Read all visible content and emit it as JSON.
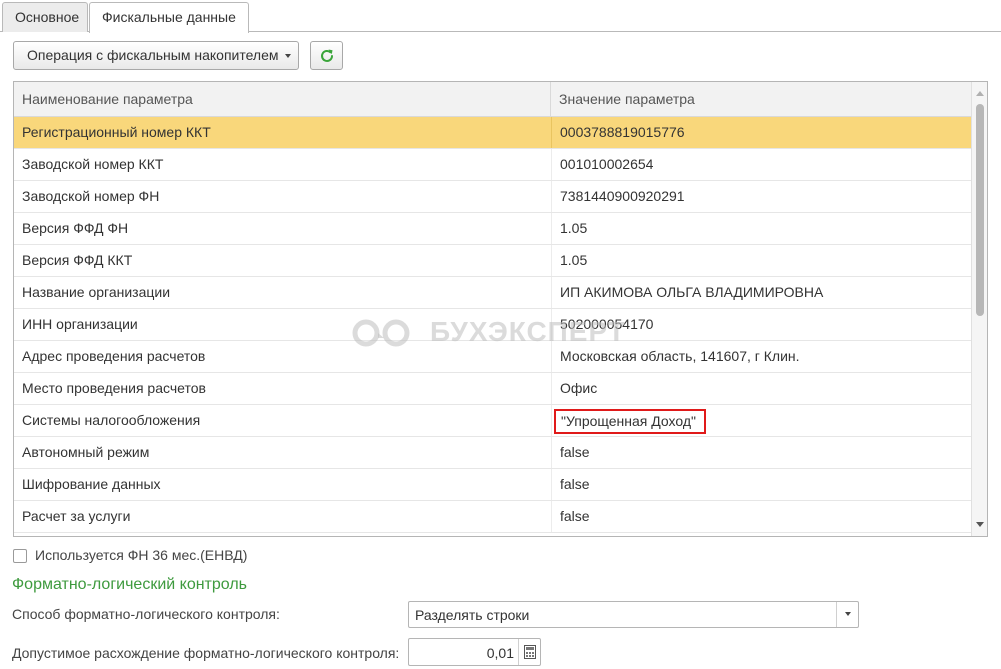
{
  "tabs": [
    {
      "label": "Основное",
      "active": false
    },
    {
      "label": "Фискальные данные",
      "active": true
    }
  ],
  "toolbar": {
    "operation_label": "Операция с фискальным накопителем",
    "refresh_icon": "refresh-icon"
  },
  "table": {
    "columns": [
      "Наименование параметра",
      "Значение параметра"
    ],
    "rows": [
      {
        "name": "Регистрационный номер ККТ",
        "value": "0003788819015776"
      },
      {
        "name": "Заводской номер ККТ",
        "value": "001010002654"
      },
      {
        "name": "Заводской номер ФН",
        "value": "7381440900920291"
      },
      {
        "name": "Версия ФФД ФН",
        "value": "1.05"
      },
      {
        "name": "Версия ФФД ККТ",
        "value": "1.05"
      },
      {
        "name": "Название организации",
        "value": "ИП АКИМОВА ОЛЬГА ВЛАДИМИРОВНА"
      },
      {
        "name": "ИНН организации",
        "value": "502000054170"
      },
      {
        "name": "Адрес проведения расчетов",
        "value": "Московская область, 141607, г Клин."
      },
      {
        "name": "Место проведения расчетов",
        "value": "Офис"
      },
      {
        "name": "Системы налогообложения",
        "value": "\"Упрощенная Доход\""
      },
      {
        "name": "Автономный режим",
        "value": "false"
      },
      {
        "name": "Шифрование данных",
        "value": "false"
      },
      {
        "name": "Расчет за услуги",
        "value": "false"
      }
    ],
    "selected_index": 0,
    "highlighted_index": 9
  },
  "watermark": "БУХЭКСПЕРТ",
  "form": {
    "fn36_label": "Используется ФН 36 мес.(ЕНВД)",
    "fn36_checked": false,
    "flk_title": "Форматно-логический контроль",
    "flk_method_label": "Способ форматно-логического контроля:",
    "flk_method_value": "Разделять строки",
    "flk_tolerance_label": "Допустимое расхождение форматно-логического контроля:",
    "flk_tolerance_value": "0,01"
  },
  "colors": {
    "selected_row": "#f9d77b",
    "highlight_border": "#e01a1a",
    "section_title": "#3e9a3e",
    "refresh_icon": "#3aa53a"
  }
}
